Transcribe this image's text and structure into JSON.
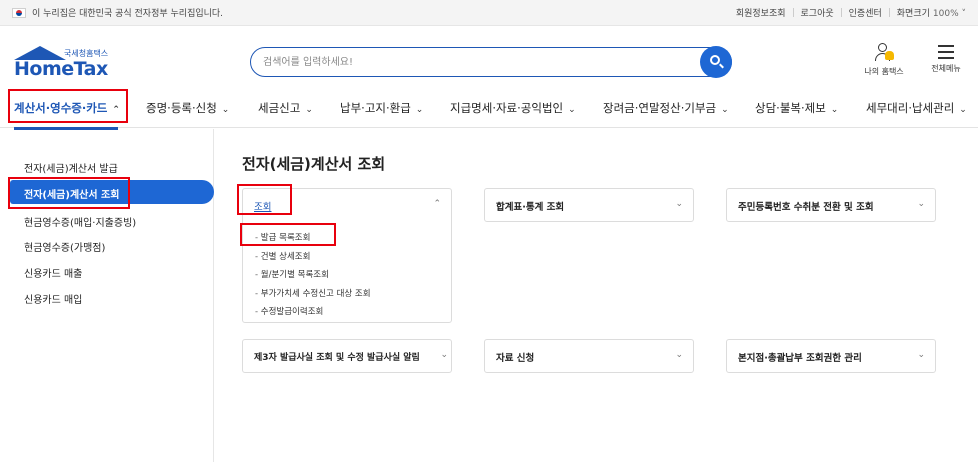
{
  "topbar": {
    "gov_notice": "이 누리집은 대한민국 공식 전자정부 누리집입니다.",
    "links": [
      "회원정보조회",
      "로그아웃",
      "인증센터"
    ],
    "zoom_label": "화면크기",
    "zoom_value": "100% ˅"
  },
  "logo": {
    "sub": "국세청홈택스",
    "main": "HomeTax"
  },
  "search": {
    "placeholder": "검색어를 입력하세요!"
  },
  "header": {
    "my_home": "나의 홈택스",
    "all_menu": "전체메뉴"
  },
  "nav": {
    "items": [
      {
        "label": "계산서·영수증·카드",
        "chev": "⌃"
      },
      {
        "label": "증명·등록·신청",
        "chev": "⌄"
      },
      {
        "label": "세금신고",
        "chev": "⌄"
      },
      {
        "label": "납부·고지·환급",
        "chev": "⌄"
      },
      {
        "label": "지급명세·자료·공익법인",
        "chev": "⌄"
      },
      {
        "label": "장려금·연말정산·기부금",
        "chev": "⌄"
      },
      {
        "label": "상담·불복·제보",
        "chev": "⌄"
      },
      {
        "label": "세무대리·납세관리",
        "chev": "⌄"
      }
    ]
  },
  "sidebar": {
    "items": [
      {
        "label": "전자(세금)계산서 발급"
      },
      {
        "label": "전자(세금)계산서 조회"
      },
      {
        "label": "현금영수증(매입·지출증빙)"
      },
      {
        "label": "현금영수증(가맹점)"
      },
      {
        "label": "신용카드 매출"
      },
      {
        "label": "신용카드 매입"
      }
    ]
  },
  "main": {
    "title": "전자(세금)계산서 조회",
    "cards": [
      {
        "title": "조회",
        "chev": "⌃",
        "items": [
          "발급 목록조회",
          "건별 상세조회",
          "월/분기별 목록조회",
          "부가가치세 수정신고 대상 조회",
          "수정발급이력조회"
        ]
      },
      {
        "title": "합계표·통계 조회",
        "chev": "⌄"
      },
      {
        "title": "주민등록번호 수취분 전환 및 조회",
        "chev": "⌄"
      },
      {
        "title": "제3자 발급사실 조회 및 수정 발급사실 알림",
        "chev": "⌄"
      },
      {
        "title": "자료 신청",
        "chev": "⌄"
      },
      {
        "title": "본지점·총괄납부 조회권한 관리",
        "chev": "⌄"
      }
    ]
  },
  "colors": {
    "brand": "#1e57b5",
    "accent": "#1e67d4",
    "highlight": "#e8000d"
  }
}
